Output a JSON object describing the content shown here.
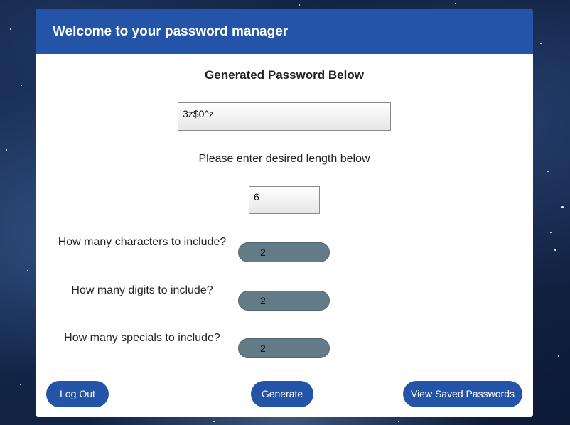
{
  "header": {
    "title": "Welcome to your password manager"
  },
  "generator": {
    "heading": "Generated Password Below",
    "password_value": "3z$0^z",
    "length_label": "Please enter desired length below",
    "length_value": "6"
  },
  "options": [
    {
      "label": "How many characters to include?",
      "value": "2"
    },
    {
      "label": "How many digits to include?",
      "value": "2"
    },
    {
      "label": "How many specials to include?",
      "value": "2"
    }
  ],
  "buttons": {
    "logout": "Log Out",
    "generate": "Generate",
    "view_saved": "View Saved Passwords"
  },
  "colors": {
    "header_bg": "#2454a7",
    "button_bg": "#2454a7",
    "pill_bg": "#627b87"
  }
}
